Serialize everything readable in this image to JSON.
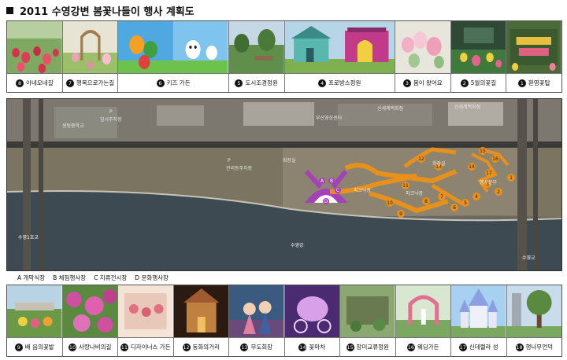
{
  "title": "2011 수영강변 봄꽃나들이 행사 계획도",
  "top_items": [
    {
      "num": "8",
      "label": "아네모네길",
      "icon": "tulip-photo"
    },
    {
      "num": "7",
      "label": "행복으로가는길",
      "icon": "garden-arch-photo"
    },
    {
      "num": "6",
      "label": "키즈 가든",
      "icon": "kids-character-photo"
    },
    {
      "num": "5",
      "label": "도시조경정원",
      "icon": "city-garden-photo"
    },
    {
      "num": "4",
      "label": "프로방스정원",
      "icon": "provence-house-photo"
    },
    {
      "num": "3",
      "label": "봄이 왔어요",
      "icon": "spring-flowers-photo"
    },
    {
      "num": "2",
      "label": "5월의꽃길",
      "icon": "flower-road-photo"
    },
    {
      "num": "1",
      "label": "환영꽃탑",
      "icon": "welcome-flower-tower-photo"
    }
  ],
  "map": {
    "labels": {
      "a": "센텀중학교",
      "b": "임시주차장",
      "c": "부산영상센터",
      "d": "신세계백화점",
      "e": "관리동주차장",
      "f": "화장실",
      "g": "피크닉장",
      "h": "피크닉장",
      "i": "화장실",
      "j": "행사본부",
      "k": "수영1호교",
      "l": "수영강",
      "m": "수영교",
      "n": "P",
      "o": "P",
      "p": "신세계백화점"
    },
    "zone_letters": [
      "A",
      "B",
      "C",
      "D"
    ],
    "markers": [
      "1",
      "2",
      "3",
      "4",
      "5",
      "6",
      "7",
      "8",
      "9",
      "10",
      "11",
      "12",
      "13",
      "14",
      "15",
      "16",
      "17"
    ],
    "colors": {
      "path": "#e8901c",
      "stage": "#a640b8",
      "river": "#3d4a52"
    }
  },
  "legend": [
    "A 개막식장",
    "B 체험행사장",
    "C 지류전시장",
    "D 문화행사장"
  ],
  "bottom_items": [
    {
      "num": "9",
      "label": "배 음의꽃밭",
      "icon": "flowerbed-photo"
    },
    {
      "num": "10",
      "label": "사랑나비의길",
      "icon": "butterfly-road-photo"
    },
    {
      "num": "11",
      "label": "디자이너스 가든",
      "icon": "designers-garden-photo"
    },
    {
      "num": "12",
      "label": "동화의거리",
      "icon": "fairytale-street-photo"
    },
    {
      "num": "13",
      "label": "무도회장",
      "icon": "ballroom-photo"
    },
    {
      "num": "14",
      "label": "꽃마차",
      "icon": "flower-carriage-photo"
    },
    {
      "num": "15",
      "label": "장미교류정원",
      "icon": "rose-garden-photo"
    },
    {
      "num": "16",
      "label": "웨딩가든",
      "icon": "wedding-garden-photo"
    },
    {
      "num": "17",
      "label": "신데렐라 성",
      "icon": "cinderella-castle-photo"
    },
    {
      "num": "18",
      "label": "행나무언덕",
      "icon": "tree-hill-photo"
    }
  ]
}
